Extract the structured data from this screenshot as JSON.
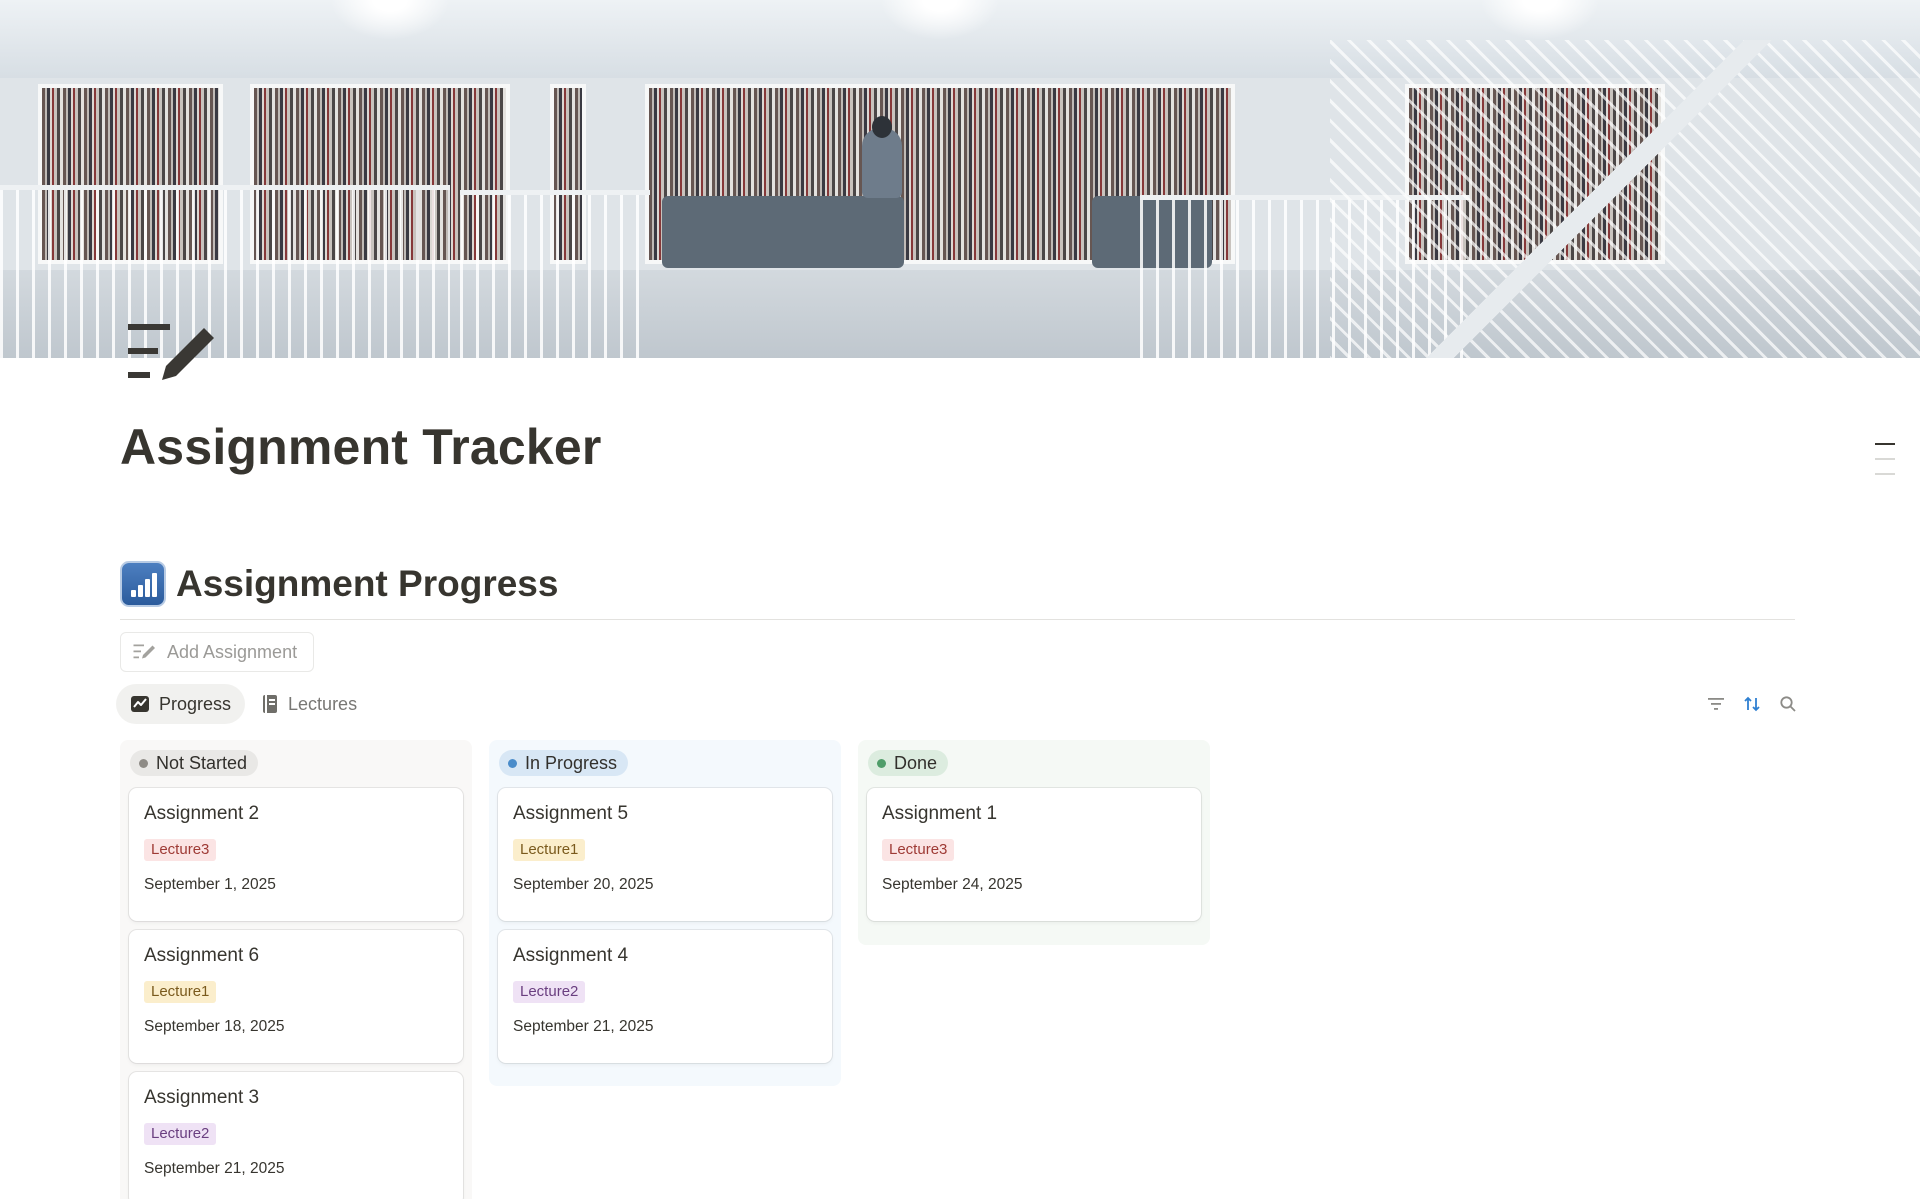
{
  "page": {
    "title": "Assignment Tracker",
    "icon": "edit-list-icon"
  },
  "section": {
    "icon": "bar-chart-icon",
    "title": "Assignment Progress"
  },
  "add_button": {
    "label": "Add Assignment",
    "icon": "edit-list-icon"
  },
  "views": {
    "tabs": [
      {
        "label": "Progress",
        "icon": "chart-line-icon",
        "active": true
      },
      {
        "label": "Lectures",
        "icon": "notebook-icon",
        "active": false
      }
    ],
    "tools": [
      "filter-icon",
      "sort-icon",
      "search-icon"
    ]
  },
  "colors": {
    "accent_sort": "#2f80d1",
    "not_started_dot": "#8e8b86",
    "in_progress_dot": "#4a8cca",
    "done_dot": "#4f9d69"
  },
  "board": {
    "columns": [
      {
        "status": "Not Started",
        "cards": [
          {
            "title": "Assignment 2",
            "lecture": "Lecture3",
            "date": "September 1, 2025"
          },
          {
            "title": "Assignment 6",
            "lecture": "Lecture1",
            "date": "September 18, 2025"
          },
          {
            "title": "Assignment 3",
            "lecture": "Lecture2",
            "date": "September 21, 2025"
          }
        ]
      },
      {
        "status": "In Progress",
        "cards": [
          {
            "title": "Assignment 5",
            "lecture": "Lecture1",
            "date": "September 20, 2025"
          },
          {
            "title": "Assignment 4",
            "lecture": "Lecture2",
            "date": "September 21, 2025"
          }
        ]
      },
      {
        "status": "Done",
        "cards": [
          {
            "title": "Assignment 1",
            "lecture": "Lecture3",
            "date": "September 24, 2025"
          }
        ]
      }
    ]
  }
}
